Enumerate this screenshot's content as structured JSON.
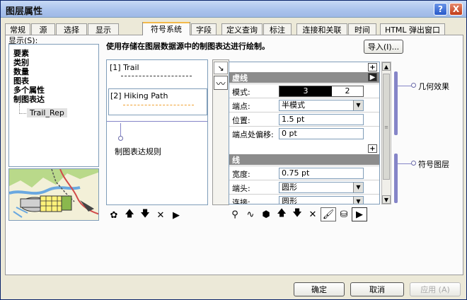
{
  "window": {
    "title": "图层属性"
  },
  "title_buttons": {
    "help": "?",
    "close": "X"
  },
  "tabs": [
    {
      "label": "常规"
    },
    {
      "label": "源"
    },
    {
      "label": "选择"
    },
    {
      "label": "显示"
    },
    {
      "label": "符号系统"
    },
    {
      "label": "字段"
    },
    {
      "label": "定义查询"
    },
    {
      "label": "标注"
    },
    {
      "label": "连接和关联"
    },
    {
      "label": "时间"
    },
    {
      "label": "HTML 弹出窗口"
    }
  ],
  "show": {
    "label": "显示(S):",
    "items": [
      "要素",
      "类别",
      "数量",
      "图表",
      "多个属性",
      "制图表达"
    ],
    "selected_child": "Trail_Rep"
  },
  "description": "使用存储在图层数据源中的制图表达进行绘制。",
  "import_button": "导入(I)...",
  "rules": [
    {
      "label": "[1] Trail",
      "line_color": "#333333"
    },
    {
      "label": "[2] Hiking Path",
      "line_color": "#f0a030"
    }
  ],
  "rules_annotation": "制图表达规则",
  "geom_annotation": "几何效果",
  "symbol_annotation": "符号图层",
  "dashed": {
    "header": "虚线",
    "pattern_label": "模式:",
    "pattern_values": [
      "3",
      "2"
    ],
    "cap_label": "端点:",
    "cap_value": "半模式",
    "position_label": "位置:",
    "position_value": "1.5 pt",
    "offset_label": "端点处偏移:",
    "offset_value": "0 pt"
  },
  "line": {
    "header": "线",
    "width_label": "宽度:",
    "width_value": "0.75 pt",
    "cap_label": "端头:",
    "cap_value": "圆形",
    "join_label": "连接:",
    "join_value": "圆形"
  },
  "buttons": {
    "ok": "确定",
    "cancel": "取消",
    "apply": "应用 (A)"
  },
  "colors": {
    "accent_tab": "#f2b94a",
    "hiking_line": "#f0a030",
    "annotation": "#8585c8"
  }
}
